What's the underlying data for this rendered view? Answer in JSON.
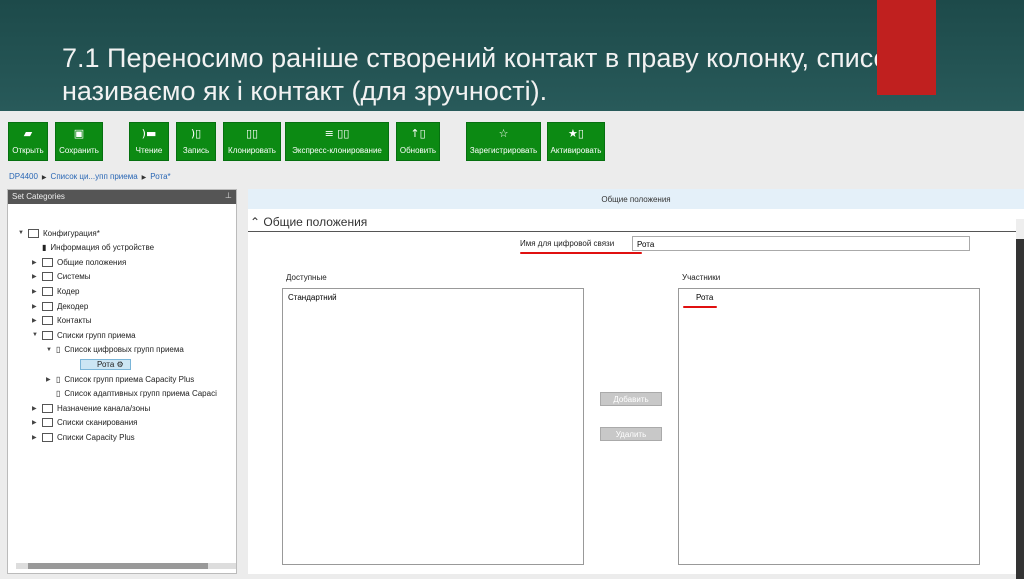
{
  "slide_title": "7.1 Переносимо раніше створений контакт в праву колонку, список називаємо як і контакт (для зручності).",
  "toolbar": [
    {
      "icon": "folder-open-icon",
      "glyph": "▰",
      "label": "Открыть"
    },
    {
      "icon": "save-icon",
      "glyph": "▣",
      "label": "Сохранить"
    },
    {
      "icon": "read-icon",
      "glyph": ")▬",
      "label": "Чтение"
    },
    {
      "icon": "write-icon",
      "glyph": ")▯",
      "label": "Запись"
    },
    {
      "icon": "clone-icon",
      "glyph": "▯▯",
      "label": "Клонировать"
    },
    {
      "icon": "express-clone-icon",
      "glyph": "≡ ▯▯",
      "label": "Экспресс-клонирование"
    },
    {
      "icon": "update-icon",
      "glyph": "↑▯",
      "label": "Обновить"
    },
    {
      "icon": "star-icon",
      "glyph": "☆",
      "label": "Зарегистрировать"
    },
    {
      "icon": "activate-icon",
      "glyph": "★▯",
      "label": "Активировать"
    }
  ],
  "breadcrumb": [
    "DP4400",
    "Список ци...упп приема",
    "Рота*"
  ],
  "sidebar": {
    "title": "Set Categories",
    "items": [
      "Конфигурация*",
      "Информация об устройстве",
      "Общие положения",
      "Системы",
      "Кодер",
      "Декодер",
      "Контакты",
      "Списки групп приема",
      "Список цифровых групп приема",
      "Рота",
      "Список групп приема Capacity Plus",
      "Список адаптивных групп приема Capaci",
      "Назначение канала/зоны",
      "Списки сканирования",
      "Списки Capacity Plus"
    ]
  },
  "main": {
    "header": "Общие положения",
    "section": "Общие положения",
    "name_label": "Имя для цифровой связи",
    "name_value": "Рота",
    "available_label": "Доступные",
    "available_items": [
      "Стандартний"
    ],
    "members_label": "Участники",
    "members_items": [
      "Рота"
    ],
    "add_button": "Добавить",
    "remove_button": "Удалить"
  }
}
